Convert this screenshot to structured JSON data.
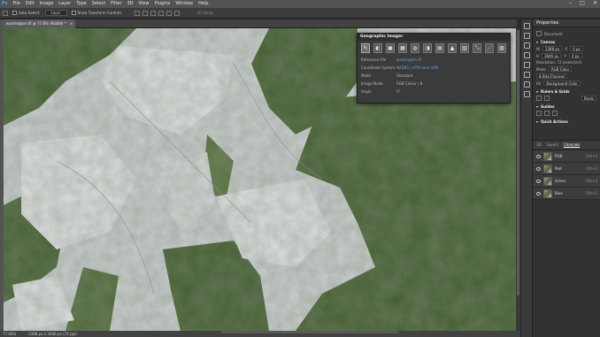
{
  "menubar": {
    "items": [
      "Ps",
      "File",
      "Edit",
      "Image",
      "Layer",
      "Type",
      "Select",
      "Filter",
      "3D",
      "View",
      "Plugins",
      "Window",
      "Help"
    ],
    "window_controls": [
      "–",
      "□",
      "✕"
    ]
  },
  "options_bar": {
    "auto_select_label": "Auto-Select:",
    "layer_select_value": "Layer",
    "show_transform_label": "Show Transform Controls",
    "mode_3d_label": "3D Mode:"
  },
  "document": {
    "tab_title": "washington.tif @ 77.8% (RGB/8) *",
    "tab_close": "×",
    "zoom": "77.84%",
    "dimensions": "2388 px x 3946 px (72 ppi)"
  },
  "geo_panel": {
    "title": "Geographic Imager",
    "tool_icons": [
      "✎",
      "◐",
      "▣",
      "▦",
      "◍",
      "◑",
      "▤",
      "▲",
      "▥",
      "⤡",
      "⋰",
      "▧"
    ],
    "rows": [
      {
        "label": "Reference File",
        "value": "washington.tif"
      },
      {
        "label": "Coordinate System",
        "value": "NAD83 / UTM zone 10N"
      },
      {
        "label": "Mode",
        "value": "Standard"
      },
      {
        "label": "Image Mode",
        "value": "RGB Colour | 8"
      },
      {
        "label": "Angle",
        "value": "0°"
      }
    ]
  },
  "properties": {
    "title": "Properties",
    "doc_label": "Document",
    "canvas_header": "Canvas",
    "w_label": "W",
    "w_value": "2388 px",
    "h_label": "H",
    "h_value": "3946 px",
    "x_label": "X",
    "x_value": "0 px",
    "y_label": "Y",
    "y_value": "0 px",
    "resolution": "Resolution: 72 pixels/inch",
    "mode_label": "Mode",
    "mode_value": "RGB Color",
    "depth_value": "8 Bits/Channel",
    "fill_label": "Fill",
    "fill_value": "Background Color",
    "rulers_header": "Rulers & Grids",
    "rulers_unit": "Pixels",
    "guides_header": "Guides",
    "quick_actions_header": "Quick Actions"
  },
  "channels": {
    "tabs": [
      "3D",
      "Layers",
      "Channels"
    ],
    "active_tab": "Channels",
    "rows": [
      {
        "name": "RGB",
        "shortcut": "Ctrl+2"
      },
      {
        "name": "Red",
        "shortcut": "Ctrl+3"
      },
      {
        "name": "Green",
        "shortcut": "Ctrl+4"
      },
      {
        "name": "Blue",
        "shortcut": "Ctrl+5"
      }
    ]
  },
  "colors": {
    "accent": "#5fa8e6",
    "ui_dark": "#323232",
    "forest": "#3f5a2a",
    "snow": "#e4e6e8"
  }
}
